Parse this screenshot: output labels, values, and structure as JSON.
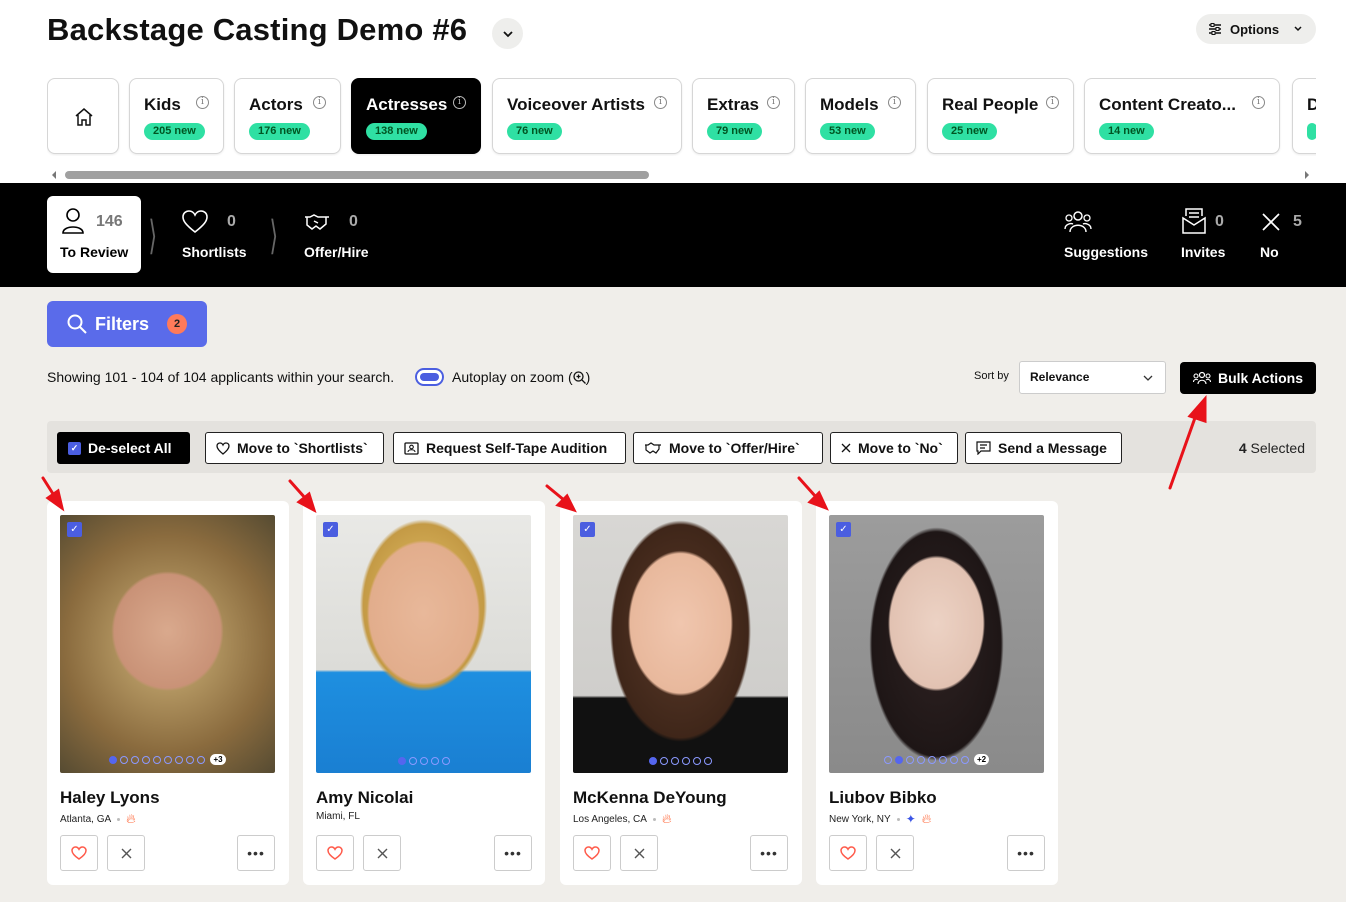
{
  "header": {
    "title": "Backstage Casting Demo #6",
    "options_label": "Options"
  },
  "tabs": [
    {
      "label": "",
      "new": "",
      "icon": "home-icon"
    },
    {
      "label": "Kids",
      "new": "205 new"
    },
    {
      "label": "Actors",
      "new": "176 new"
    },
    {
      "label": "Actresses",
      "new": "138 new",
      "active": true
    },
    {
      "label": "Voiceover Artists",
      "new": "76 new"
    },
    {
      "label": "Extras",
      "new": "79 new"
    },
    {
      "label": "Models",
      "new": "53 new"
    },
    {
      "label": "Real People",
      "new": "25 new"
    },
    {
      "label": "Content Creato...",
      "new": "14 new"
    },
    {
      "label": "D",
      "new": ""
    }
  ],
  "stages": {
    "to_review": {
      "label": "To Review",
      "count": "146"
    },
    "shortlists": {
      "label": "Shortlists",
      "count": "0"
    },
    "offer_hire": {
      "label": "Offer/Hire",
      "count": "0"
    },
    "suggestions": {
      "label": "Suggestions"
    },
    "invites": {
      "label": "Invites",
      "count": "0"
    },
    "no": {
      "label": "No",
      "count": "5"
    }
  },
  "filters": {
    "label": "Filters",
    "count": "2"
  },
  "results": {
    "showing": "Showing 101 - 104 of 104 applicants within your search.",
    "autoplay": "Autoplay on zoom",
    "sort_label": "Sort by",
    "sort_value": "Relevance",
    "bulk_actions": "Bulk Actions"
  },
  "actionbar": {
    "deselect": "De-select All",
    "shortlists": "Move to `Shortlists`",
    "selftape": "Request Self-Tape Audition",
    "offer": "Move to `Offer/Hire`",
    "no": "Move to `No`",
    "message": "Send a Message",
    "selected_count": "4",
    "selected_label": "Selected"
  },
  "cards": [
    {
      "name": "Haley Lyons",
      "location": "Atlanta, GA",
      "photo_count_extra": "+3",
      "accent": "#6b5a3e"
    },
    {
      "name": "Amy Nicolai",
      "location": "Miami, FL",
      "photo_count_extra": "",
      "accent": "#1e8fe0"
    },
    {
      "name": "McKenna DeYoung",
      "location": "Los Angeles, CA",
      "photo_count_extra": "",
      "accent": "#4a3126"
    },
    {
      "name": "Liubov Bibko",
      "location": "New York, NY",
      "photo_count_extra": "+2",
      "accent": "#2a2324"
    }
  ],
  "colors": {
    "accent": "#5a6bea",
    "new_badge": "#2fe0a3",
    "arrow": "#e8121a"
  }
}
